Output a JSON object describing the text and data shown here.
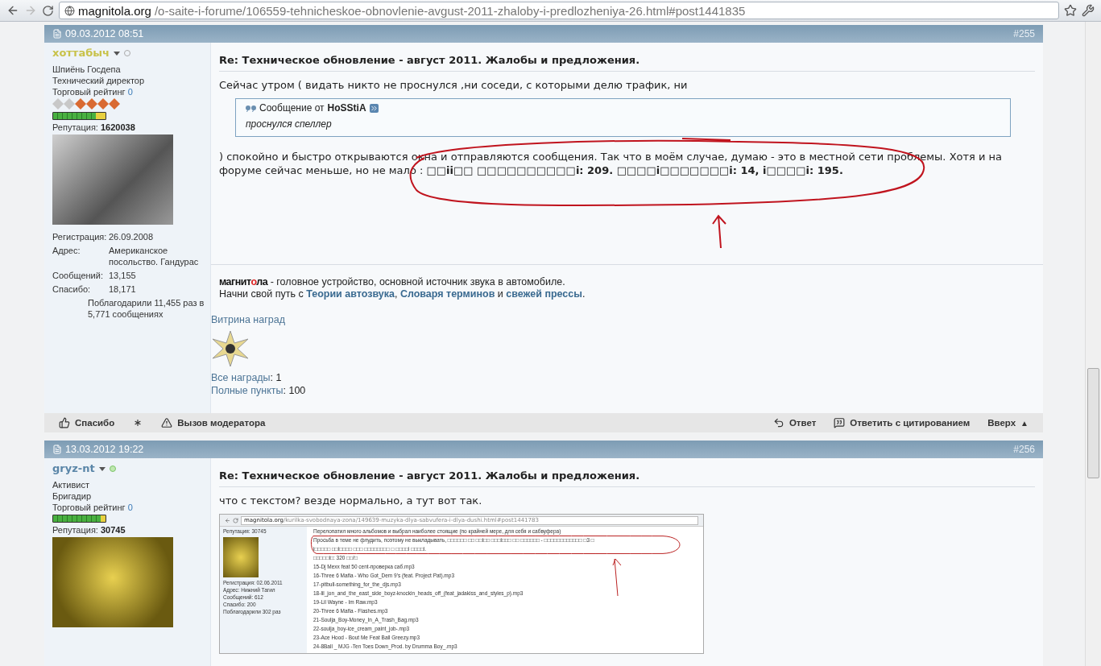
{
  "browser": {
    "url_domain": "magnitola.org",
    "url_path": "/o-saite-i-forume/106559-tehnicheskoe-obnovlenie-avgust-2011-zhaloby-i-predlozheniya-26.html#post1441835"
  },
  "posts": [
    {
      "date": "09.03.2012 08:51",
      "number": "#255",
      "user": {
        "name": "хоттабыч",
        "color": "#c8c24a",
        "online": false,
        "titles": [
          "Шпиёнь Госдепа",
          "Технический директор"
        ],
        "trade_label": "Торговый рейтинг",
        "trade_value": "0",
        "stars": 4,
        "reputation_bar": {
          "level": 0.82
        },
        "rep_label": "Репутация:",
        "rep_value": "1620038",
        "avatar": {
          "kind": "photo"
        },
        "details": [
          {
            "label": "Регистрация:",
            "value": "26.09.2008"
          },
          {
            "label": "Адрес:",
            "value": "Американское посольство. Гандурас"
          },
          {
            "label": "Сообщений:",
            "value": "13,155"
          },
          {
            "label": "Спасибо:",
            "value": "18,171"
          }
        ],
        "thanks_note": "Поблагодарили 11,455 раз в 5,771 сообщениях"
      },
      "title": "Re: Техническое обновление - август 2011. Жалобы и предложения.",
      "blocks": [
        {
          "kind": "text",
          "text": "Сейчас утром ( видать никто не проснулся ,ни соседи, с которыми делю трафик, ни"
        },
        {
          "kind": "quote",
          "label": "Сообщение от",
          "author": "HoSStiA",
          "text": "проснулся спеллер"
        },
        {
          "kind": "text",
          "annotated": true,
          "text": ") спокойно и быстро открываются окна и отправляются сообщения. Так что в моём случае, думаю - это в местной сети проблемы. Хотя и на форуме сейчас меньше, но не мало : **□□ii□□ □□□□□□□□□□i: 209. □□□□i□□□□□□□i: 14, i□□□□i: 195.**"
        }
      ],
      "signature": {
        "logo": [
          "магнит",
          "о",
          "ла"
        ],
        "line1": " - головное устройство, основной источник звука в автомобиле.",
        "line2": [
          {
            "kind": "text",
            "text": "Начни свой путь с "
          },
          {
            "kind": "link",
            "text": "Теории автозвука"
          },
          {
            "kind": "text",
            "text": ", "
          },
          {
            "kind": "link",
            "text": "Словаря терминов"
          },
          {
            "kind": "text",
            "text": " и "
          },
          {
            "kind": "link",
            "text": "свежей прессы"
          },
          {
            "kind": "text",
            "text": "."
          }
        ]
      },
      "awards": {
        "title": "Витрина наград",
        "stats": [
          {
            "label": "Все награды",
            "value": ": 1"
          },
          {
            "label": "Полные пункты",
            "value": ": 100"
          }
        ]
      },
      "actions_left": [
        {
          "kind": "thanks",
          "label": "Спасибо"
        },
        {
          "kind": "star"
        },
        {
          "kind": "report",
          "label": "Вызов модератора"
        }
      ],
      "actions_right": [
        {
          "kind": "reply",
          "label": "Ответ"
        },
        {
          "kind": "quote",
          "label": "Ответить с цитированием"
        },
        {
          "kind": "top",
          "label": "Вверх",
          "arrow": "▲"
        }
      ]
    },
    {
      "date": "13.03.2012 19:22",
      "number": "#256",
      "user": {
        "name": "gryz-nt",
        "color": "#5a86a8",
        "online": true,
        "titles": [
          "Активист",
          "Бригадир"
        ],
        "trade_label": "Торговый рейтинг",
        "trade_value": "0",
        "reputation_bar": {
          "level": 0.9
        },
        "rep_label": "Репутация:",
        "rep_value": "30745",
        "avatar": {
          "kind": "cover"
        }
      },
      "title": "Re: Техническое обновление - август 2011. Жалобы и предложения.",
      "blocks": [
        {
          "kind": "text",
          "text": "что с текстом? везде нормально, а тут вот так."
        },
        {
          "kind": "screenshot",
          "url_domain": "magnitola.org",
          "url_path": "/kurilka-svobodnaya-zona/149639-muzyka-dlya-sabvufera-i-dlya-dushi.html#post1441783",
          "rep": "Репутация: 30745",
          "details": [
            {
              "label": "Регистрация:",
              "value": "02.06.2011"
            },
            {
              "label": "Адрес:",
              "value": "Нижний Тагил"
            },
            {
              "label": "Сообщений:",
              "value": "612"
            },
            {
              "label": "Спасибо:",
              "value": "200"
            },
            {
              "value": "Поблагодарили 302 раз"
            }
          ],
          "lines": [
            "Перелопатил много альбомов и выбрал наиболее стоящие (по крайней мере, для себя и сабвуфера)",
            "Просьба в теме не флудить, поэтому не выкладывать, □□□□□□ □□ □□i□□ □□□i□□□ □□ □□□□□□ - □□□□□□□□□□□□ □3 □",
            "i□□□□□ □□i□□□□ □□□ □□□□□□□□ □ □□□□i □□□□i.",
            "□□□□□i□: 320 □□/□",
            "15-Dj Mexx feat 50 cent-проверка саб.mp3",
            "16-Three 6 Mafia - Who Got_Dem 9's (feat. Project Pat).mp3",
            "17-pitbull-something_for_the_djs.mp3",
            "18-lil_jon_and_the_east_side_boyz-knockin_heads_off_(feat_jadakiss_and_styles_p).mp3",
            "19-Lil Wayne - Im Raw.mp3",
            "20-Three 6 Mafia - Flashes.mp3",
            "21-Soulja_Boy-Money_In_A_Trash_Bag.mp3",
            "22-soulja_boy-ice_cream_paint_job-.mp3",
            "23-Ace Hood - Bout Me Feat Ball Greezy.mp3",
            "24-8Ball _ MJG -Ten Toes Down_Prod. by Drumma Boy_.mp3"
          ],
          "annotated": true
        }
      ]
    }
  ]
}
